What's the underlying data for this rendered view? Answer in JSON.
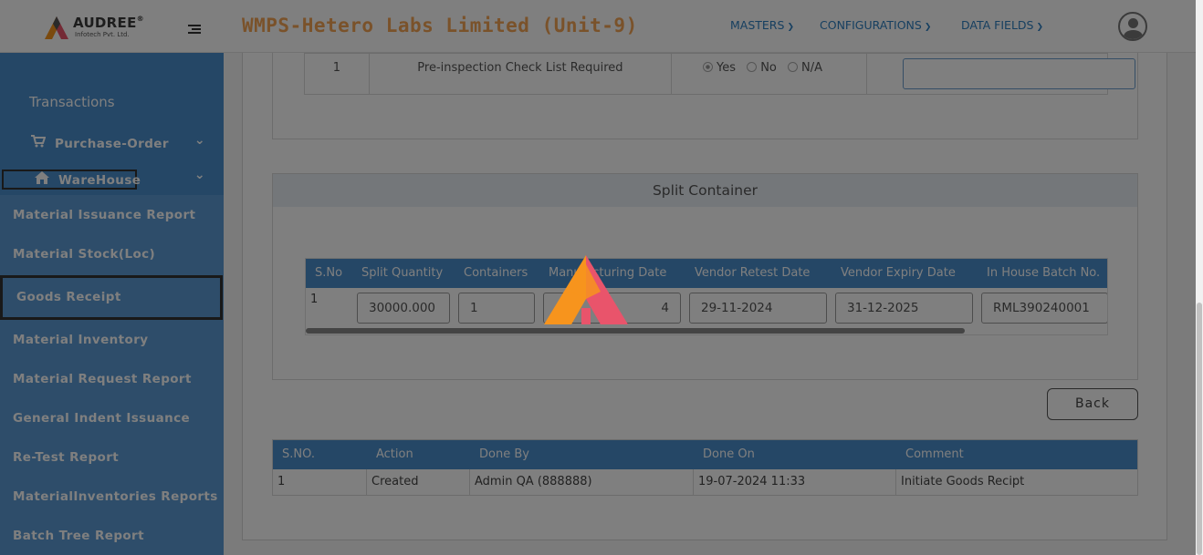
{
  "brand": {
    "name": "AUDREE",
    "reg": "®",
    "sub": "Infotech Pvt. Ltd."
  },
  "header": {
    "title": "WMPS-Hetero Labs Limited (Unit-9)",
    "nav": [
      {
        "label": "MASTERS"
      },
      {
        "label": "CONFIGURATIONS"
      },
      {
        "label": "DATA FIELDS"
      }
    ],
    "user_icon": "user-avatar-icon"
  },
  "sidebar": {
    "section_title": "Transactions",
    "groups": [
      {
        "label": "Purchase-Order",
        "icon": "cart-icon"
      },
      {
        "label": "WareHouse",
        "icon": "home-icon"
      }
    ],
    "links": [
      "Material Issuance Report",
      "Material Stock(Loc)",
      "Goods Receipt",
      "Material Inventory",
      "Material Request Report",
      "General Indent Issuance",
      "Re-Test Report",
      "MaterialInventories Reports",
      "Batch Tree Report"
    ]
  },
  "checklist": {
    "row": {
      "sno": "1",
      "label": "Pre-inspection Check List Required"
    },
    "options": [
      "Yes",
      "No",
      "N/A"
    ],
    "selected": "Yes",
    "comment_value": ""
  },
  "split_container": {
    "title": "Split Container",
    "columns": [
      "S.No",
      "Split Quantity",
      "Containers",
      "Manufacturing Date",
      "Vendor Retest Date",
      "Vendor Expiry Date",
      "In House Batch No."
    ],
    "row": {
      "sno": "1",
      "split_quantity": "30000.000",
      "containers": "1",
      "manufacturing_date": "4",
      "vendor_retest_date": "29-11-2024",
      "vendor_expiry_date": "31-12-2025",
      "in_house_batch_no": "RML390240001"
    }
  },
  "back_button": "Back",
  "audit": {
    "columns": [
      "S.NO.",
      "Action",
      "Done By",
      "Done On",
      "Comment"
    ],
    "row": {
      "sno": "1",
      "action": "Created",
      "done_by": "Admin QA (888888)",
      "done_on": "19-07-2024 11:33",
      "comment": "Initiate Goods Recipt"
    }
  },
  "colors": {
    "primary": "#4b8fcd",
    "title_orange": "#f5a455",
    "nav_blue": "#2d7fc1",
    "loader_orange": "#f7941d",
    "loader_pink": "#e9546b"
  }
}
